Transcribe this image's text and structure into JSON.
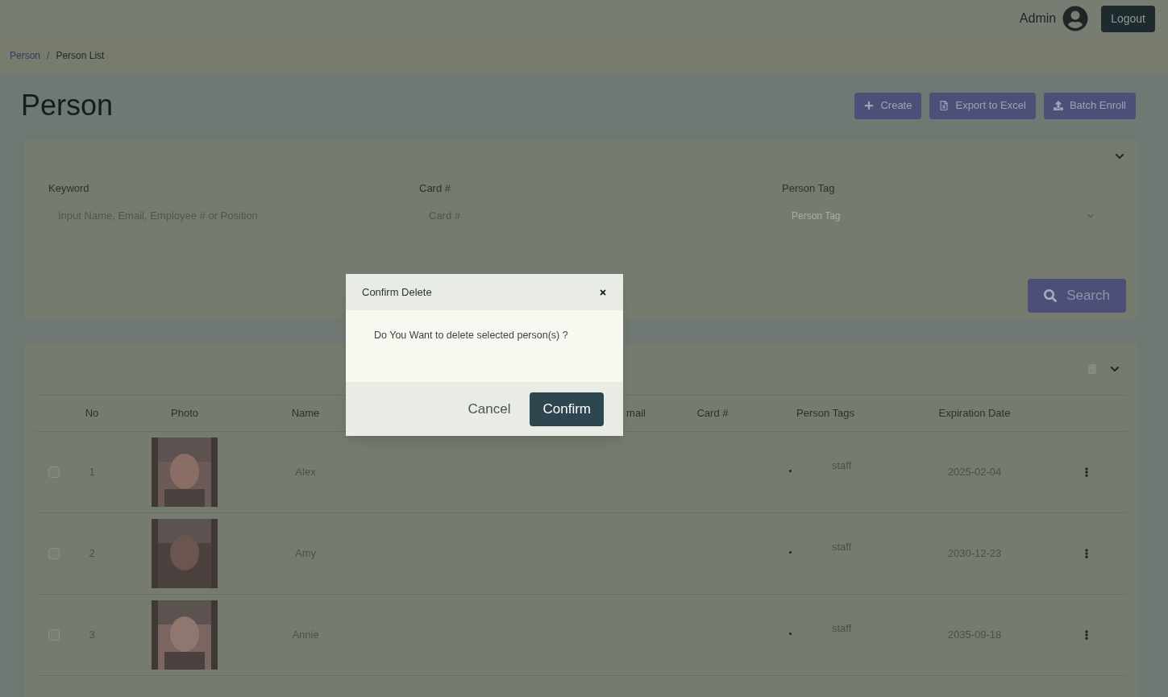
{
  "topbar": {
    "user": "Admin",
    "logout": "Logout"
  },
  "breadcrumb": {
    "separator": "/",
    "items": [
      {
        "label": "Person",
        "link": true
      },
      {
        "label": "Person List",
        "link": false
      }
    ]
  },
  "page_title": "Person",
  "actions": [
    {
      "label": "Create",
      "kind": "plus"
    },
    {
      "label": "Export to Excel",
      "kind": "file"
    },
    {
      "label": "Batch Enroll",
      "kind": "upload"
    }
  ],
  "filters": [
    {
      "label": "Keyword",
      "placeholder": "Input Name, Email, Employee # or Position",
      "kind": "text"
    },
    {
      "label": "Card #",
      "placeholder": "Card #",
      "kind": "text"
    },
    {
      "label": "Person Tag",
      "placeholder": "Person Tag",
      "kind": "select"
    }
  ],
  "search_button": "Search",
  "table": {
    "columns": [
      "No",
      "Photo",
      "Name",
      "mail",
      "Card #",
      "Person Tags",
      "Expiration Date"
    ],
    "rows": [
      {
        "checked": false,
        "no": "1",
        "photo": {
          "kind": "picture"
        },
        "name": "Alex",
        "tags": [
          "staff"
        ],
        "expiration": "2025-02-04"
      },
      {
        "checked": false,
        "no": "2",
        "photo": {
          "kind": "picture"
        },
        "name": "Amy",
        "tags": [
          "staff"
        ],
        "expiration": "2030-12-23"
      },
      {
        "checked": false,
        "no": "3",
        "photo": {
          "kind": "picture"
        },
        "name": "Annie",
        "tags": [
          "staff"
        ],
        "expiration": "2035-09-18"
      }
    ]
  },
  "dialog": {
    "title": "Confirm Delete",
    "message": "Do You Want to delete selected person(s) ?",
    "buttons": [
      {
        "label": "Cancel",
        "kind": "secondary"
      },
      {
        "label": "Confirm",
        "kind": "primary"
      }
    ]
  }
}
